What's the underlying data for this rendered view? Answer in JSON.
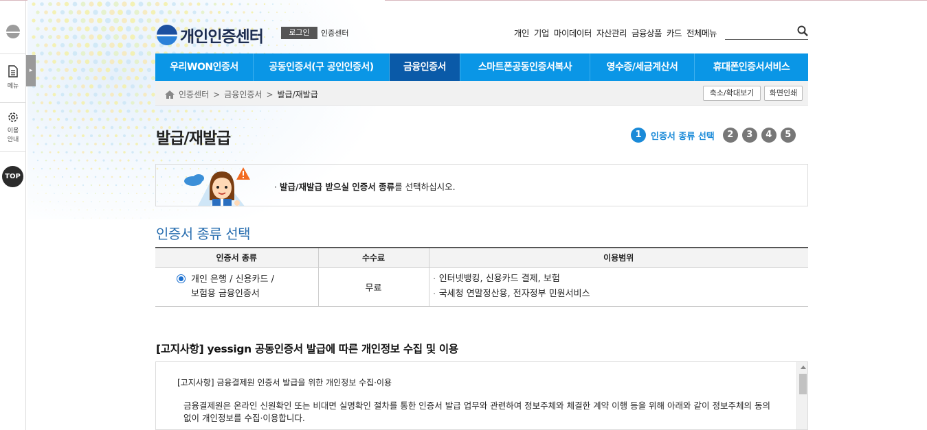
{
  "quickbar": {
    "menu_label": "메뉴",
    "guide_label_1": "이용",
    "guide_label_2": "안내",
    "top_label": "TOP"
  },
  "header": {
    "logo_title": "개인인증센터",
    "login_label": "로그인",
    "cert_center_link": "인증센터",
    "gnb": [
      "개인",
      "기업",
      "마이데이터",
      "자산관리",
      "금융상품",
      "카드",
      "전체메뉴"
    ],
    "search_placeholder": ""
  },
  "mainnav": {
    "items": [
      {
        "label": "우리WON인증서",
        "active": false
      },
      {
        "label": "공동인증서(구 공인인증서)",
        "active": false
      },
      {
        "label": "금융인증서",
        "active": true
      },
      {
        "label": "스마트폰공동인증서복사",
        "active": false
      },
      {
        "label": "영수증/세금계산서",
        "active": false
      },
      {
        "label": "휴대폰인증서서비스",
        "active": false
      }
    ]
  },
  "breadcrumb": {
    "items": [
      "인증센터",
      "금융인증서",
      "발급/재발급"
    ],
    "zoom_button": "축소/확대보기",
    "print_button": "화면인쇄"
  },
  "page": {
    "title": "발급/재발급",
    "steps": {
      "current": "1",
      "current_label": "인증서 종류 선택",
      "others": [
        "2",
        "3",
        "4",
        "5"
      ]
    },
    "info_bold": "발급/재발급 받으실 인증서 종류",
    "info_rest": "를 선택하십시오.",
    "section_title": "인증서 종류 선택"
  },
  "table": {
    "headers": [
      "인증서 종류",
      "수수료",
      "이용범위"
    ],
    "row": {
      "type_line1": "개인 은행 / 신용카드 /",
      "type_line2": "보험용 금융인증서",
      "fee": "무료",
      "uses": [
        "인터넷뱅킹, 신용카드 결제, 보험",
        "국세청 연말정산용, 전자정부 민원서비스"
      ]
    }
  },
  "notice": {
    "title": "[고지사항] yessign 공동인증서 발급에 따른 개인정보 수집 및 이용",
    "box_head": "[고지사항] 금융결제원 인증서 발급을 위한 개인정보 수집·이용",
    "box_body": "금융결제원은 온라인 신원확인 또는 비대면 실명확인 절차를 통한 인증서 발급 업무와 관련하여 정보주체와 체결한 계약 이행 등을 위해 아래와 같이 정보주체의 동의 없이 개인정보를 수집·이용합니다."
  },
  "colors": {
    "nav_blue": "#0a96e6",
    "nav_active": "#0a5aa8",
    "accent_text": "#2a6fb0"
  }
}
